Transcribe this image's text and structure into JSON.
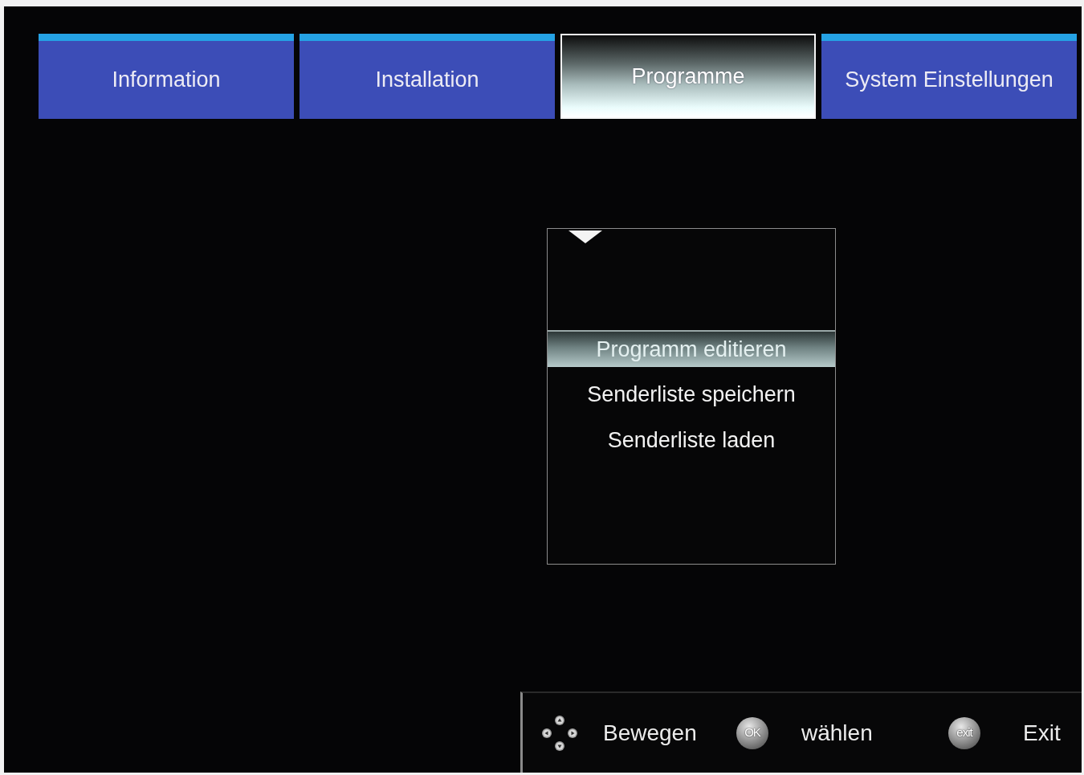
{
  "tabs": [
    {
      "label": "Information",
      "selected": false
    },
    {
      "label": "Installation",
      "selected": false
    },
    {
      "label": "Programme",
      "selected": true
    },
    {
      "label": "System Einstellungen",
      "selected": false
    }
  ],
  "menu": {
    "items": [
      {
        "label": "Programm editieren",
        "selected": true
      },
      {
        "label": "Senderliste speichern",
        "selected": false
      },
      {
        "label": "Senderliste laden",
        "selected": false
      }
    ]
  },
  "footer": {
    "hints": [
      {
        "kind": "dpad",
        "label": "Bewegen"
      },
      {
        "kind": "key",
        "key": "OK",
        "label": "wählen"
      },
      {
        "kind": "key",
        "key": "exit",
        "label": "Exit"
      }
    ]
  }
}
